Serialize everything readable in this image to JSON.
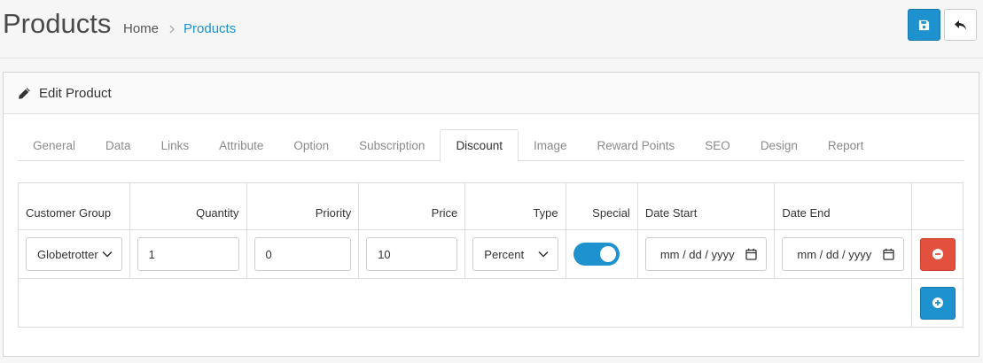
{
  "header": {
    "title": "Products",
    "breadcrumb": [
      {
        "label": "Home"
      },
      {
        "label": "Products"
      }
    ]
  },
  "card": {
    "title": "Edit Product"
  },
  "tabs": [
    {
      "label": "General",
      "active": false
    },
    {
      "label": "Data",
      "active": false
    },
    {
      "label": "Links",
      "active": false
    },
    {
      "label": "Attribute",
      "active": false
    },
    {
      "label": "Option",
      "active": false
    },
    {
      "label": "Subscription",
      "active": false
    },
    {
      "label": "Discount",
      "active": true
    },
    {
      "label": "Image",
      "active": false
    },
    {
      "label": "Reward Points",
      "active": false
    },
    {
      "label": "SEO",
      "active": false
    },
    {
      "label": "Design",
      "active": false
    },
    {
      "label": "Report",
      "active": false
    }
  ],
  "discount": {
    "columns": {
      "customer_group": "Customer Group",
      "quantity": "Quantity",
      "priority": "Priority",
      "price": "Price",
      "type": "Type",
      "special": "Special",
      "date_start": "Date Start",
      "date_end": "Date End"
    },
    "rows": [
      {
        "customer_group": "Globetrotter",
        "quantity": "1",
        "priority": "0",
        "price": "10",
        "type": "Percent",
        "special": true,
        "date_start": "mm / dd / yyyy",
        "date_end": "mm / dd / yyyy"
      }
    ]
  },
  "colors": {
    "primary": "#1e91cf",
    "danger": "#e3503e"
  }
}
